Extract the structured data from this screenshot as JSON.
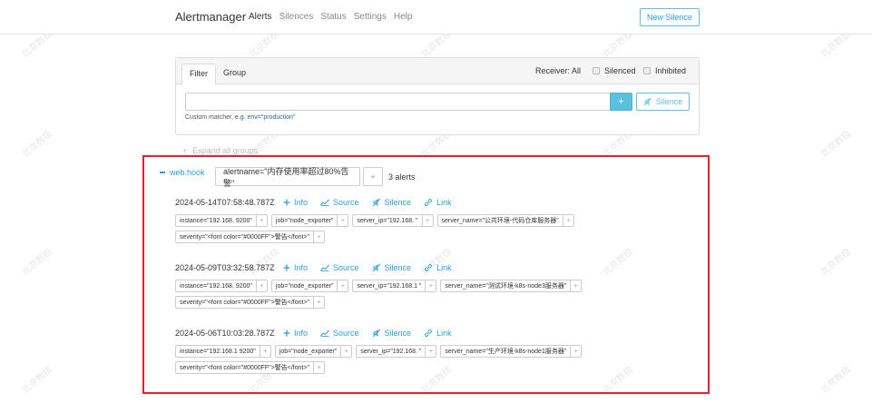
{
  "navbar": {
    "brand": "Alertmanager",
    "links": [
      "Alerts",
      "Silences",
      "Status",
      "Settings",
      "Help"
    ],
    "new_silence": "New Silence"
  },
  "filter": {
    "tabs": [
      "Filter",
      "Group"
    ],
    "receiver": "Receiver: All",
    "silenced": "Silenced",
    "inhibited": "Inhibited",
    "matcher_value": "",
    "add": "+",
    "silence_button": "Silence",
    "hint_prefix": "Custom matcher, e.g.",
    "hint_example": "env=\"production\""
  },
  "expand_all": "Expand all groups",
  "group": {
    "receiver": "web.hook",
    "label": "alertname=\"内存使用率超过80%告警\"",
    "add": "+",
    "count": "3 alerts"
  },
  "actions": [
    "Info",
    "Source",
    "Silence",
    "Link"
  ],
  "alerts": [
    {
      "timestamp": "2024-05-14T07:58:48.787Z",
      "labels_row1": [
        "instance=\"192.168.  9200\"",
        "job=\"node_exporter\"",
        "server_ip=\"192.168.   \"",
        "server_name=\"公共环境-代码仓库服务器\""
      ],
      "labels_row2": [
        "severity=\"<font color=\"#0000FF\">警告</font>\""
      ]
    },
    {
      "timestamp": "2024-05-09T03:32:58.787Z",
      "labels_row1": [
        "instance=\"192.168.  9200\"",
        "job=\"node_exporter\"",
        "server_ip=\"192.168.1   \"",
        "server_name=\"测试环境-k8s-node3服务器\""
      ],
      "labels_row2": [
        "severity=\"<font color=\"#0000FF\">警告</font>\""
      ]
    },
    {
      "timestamp": "2024-05-06T10:03:28.787Z",
      "labels_row1": [
        "instance=\"192.168.1  9200\"",
        "job=\"node_exporter\"",
        "server_ip=\"192.168.  \"",
        "server_name=\"生产环境-k8s-node1服务器\""
      ],
      "labels_row2": [
        "severity=\"<font color=\"#0000FF\">警告</font>\""
      ]
    }
  ],
  "watermark": "北京数极"
}
